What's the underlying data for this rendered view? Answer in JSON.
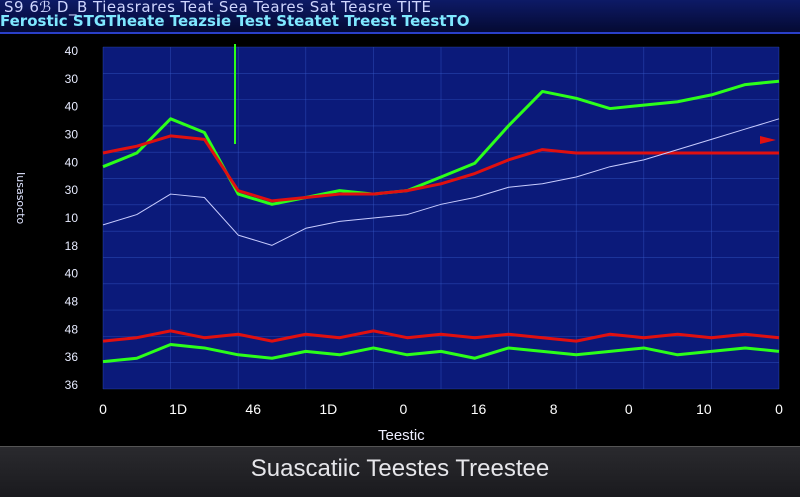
{
  "header": {
    "title_line1": "S9 6ℬ D_B Tieasrares Teat Sea Teares Sat Teasre TITE",
    "title_line2": "Ferostic STGTheate Teazsie Test Steatet Treest TeestTO"
  },
  "footer": {
    "text": "Suascatiic Teestes Treestee"
  },
  "colors": {
    "plot_bg": "#0b1a7a",
    "grid": "#3a5fd0",
    "green": "#2cff1a",
    "red": "#e01010",
    "white_trace": "#c8ccff"
  },
  "chart_data": {
    "type": "line",
    "title": "",
    "xlabel": "Teestic",
    "ylabel": "Iusasocto",
    "grid": true,
    "x_tick_labels": [
      "0",
      "1D",
      "46",
      "1D",
      "0",
      "16",
      "8",
      "0",
      "10",
      "0"
    ],
    "y_tick_labels": [
      "40",
      "30",
      "40",
      "30",
      "40",
      "30",
      "10",
      "18",
      "40",
      "48",
      "48",
      "36",
      "36"
    ],
    "x": [
      0,
      10,
      20,
      30,
      40,
      50,
      60,
      70,
      80,
      90,
      100,
      110,
      120,
      130,
      140,
      150,
      160,
      170,
      180,
      190,
      200
    ],
    "series": [
      {
        "color": "#2cff1a",
        "values": [
          20,
          24,
          34,
          30,
          12,
          9,
          11,
          13,
          12,
          13,
          17,
          21,
          32,
          42,
          40,
          37,
          38,
          39,
          41,
          44,
          45
        ]
      },
      {
        "color": "#e01010",
        "values": [
          24,
          26,
          29,
          28,
          13,
          10,
          11,
          12,
          12,
          13,
          15,
          18,
          22,
          25,
          24,
          24,
          24,
          24,
          24,
          24,
          24
        ]
      },
      {
        "color": "#c8ccff",
        "values": [
          3,
          6,
          12,
          11,
          0,
          -3,
          2,
          4,
          5,
          6,
          9,
          11,
          14,
          15,
          17,
          20,
          22,
          25,
          28,
          31,
          34
        ]
      },
      {
        "color": "#2cff1a",
        "values": [
          -37,
          -36,
          -32,
          -33,
          -35,
          -36,
          -34,
          -35,
          -33,
          -35,
          -34,
          -36,
          -33,
          -34,
          -35,
          -34,
          -33,
          -35,
          -34,
          -33,
          -34
        ]
      },
      {
        "color": "#e01010",
        "values": [
          -31,
          -30,
          -28,
          -30,
          -29,
          -31,
          -29,
          -30,
          -28,
          -30,
          -29,
          -30,
          -29,
          -30,
          -31,
          -29,
          -30,
          -29,
          -30,
          -29,
          -30
        ]
      }
    ],
    "xlim": [
      0,
      200
    ],
    "ylim": [
      -45,
      55
    ]
  }
}
